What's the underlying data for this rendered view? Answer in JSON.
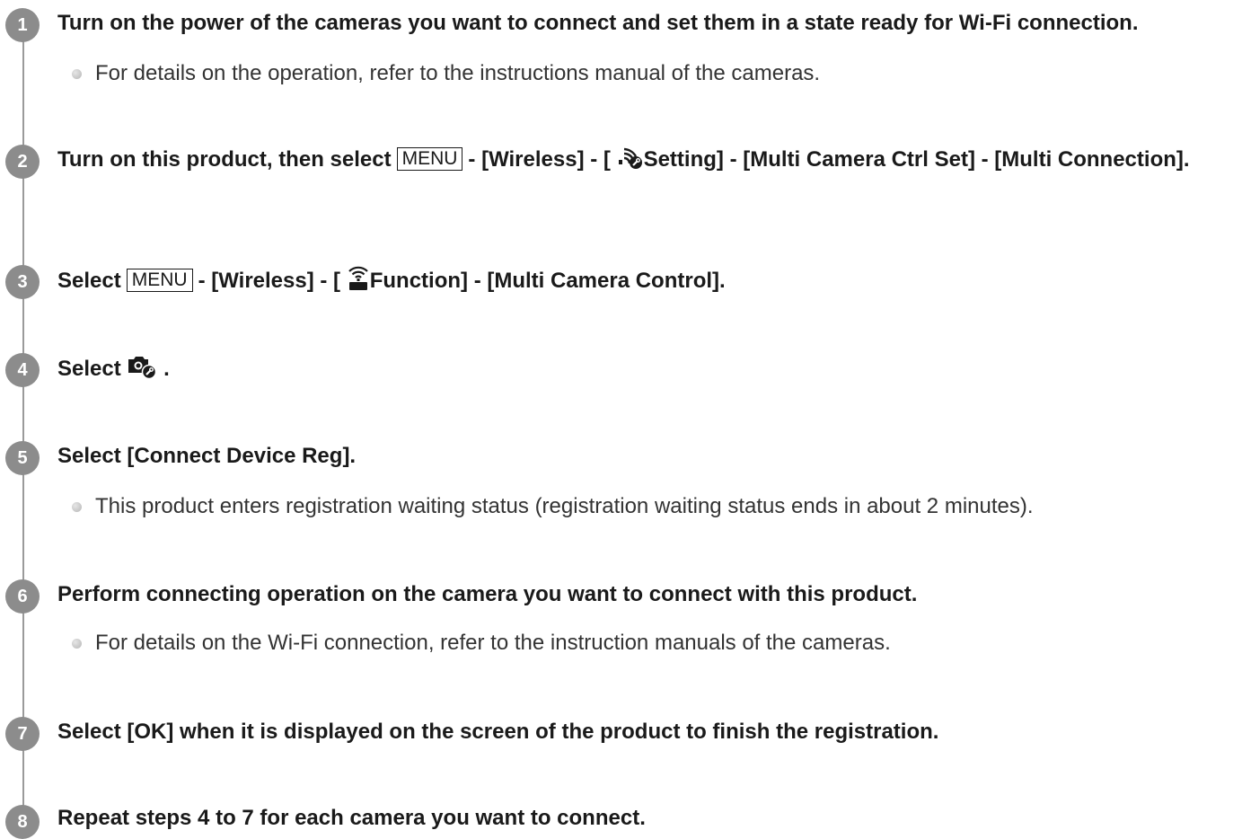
{
  "steps": [
    {
      "number": "1",
      "text": "Turn on the power of the cameras you want to connect and set them in a state ready for Wi-Fi connection.",
      "note": "For details on the operation, refer to the instructions manual of the cameras."
    },
    {
      "number": "2",
      "text_prefix": "Turn on this product, then select",
      "menu_key": "MENU",
      "text_mid": "- [Wireless] - [",
      "icon": "wifi-settings-icon",
      "text_suffix": "Setting] - [Multi Camera Ctrl Set] - [Multi Connection]."
    },
    {
      "number": "3",
      "text_prefix": "Select",
      "menu_key": "MENU",
      "text_mid": "- [Wireless] - [",
      "icon": "wifi-function-icon",
      "text_suffix": "Function] - [Multi Camera Control]."
    },
    {
      "number": "4",
      "text_prefix": "Select",
      "icon": "camera-settings-icon",
      "text_suffix": "."
    },
    {
      "number": "5",
      "text": "Select [Connect Device Reg].",
      "note": "This product enters registration waiting status (registration waiting status ends in about 2 minutes)."
    },
    {
      "number": "6",
      "text": "Perform connecting operation on the camera you want to connect with this product.",
      "note": "For details on the Wi-Fi connection, refer to the instruction manuals of the cameras."
    },
    {
      "number": "7",
      "text": "Select [OK] when it is displayed on the screen of the product to finish the registration."
    },
    {
      "number": "8",
      "text": "Repeat steps 4 to 7 for each camera you want to connect."
    }
  ],
  "colors": {
    "badge": "#8c8c8c",
    "line": "#9a9a9a",
    "text": "#1a1a1a"
  }
}
